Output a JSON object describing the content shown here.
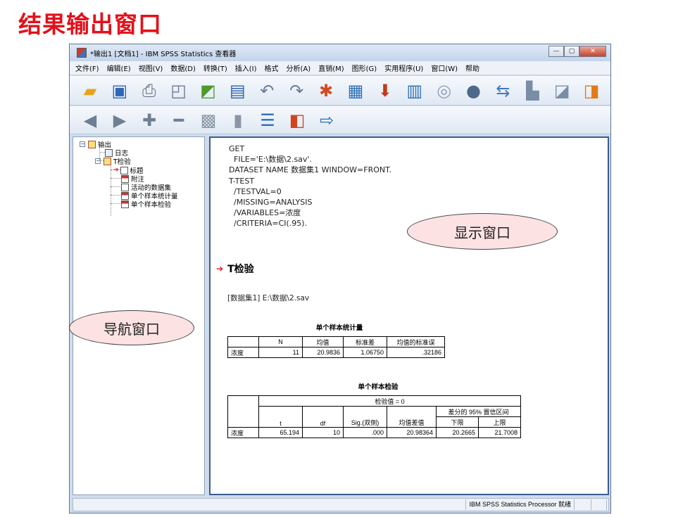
{
  "slide": {
    "title": "结果输出窗口"
  },
  "window": {
    "title": "*输出1 [文档1] - IBM SPSS Statistics 查看器",
    "buttons": {
      "minimize": "—",
      "maximize": "▢",
      "close": "✕"
    }
  },
  "menu": [
    "文件(F)",
    "编辑(E)",
    "视图(V)",
    "数据(D)",
    "转换(T)",
    "插入(I)",
    "格式",
    "分析(A)",
    "直销(M)",
    "图形(G)",
    "实用程序(U)",
    "窗口(W)",
    "帮助"
  ],
  "toolbar1_icons": [
    "open-folder-icon",
    "save-icon",
    "print-icon",
    "print-preview-icon",
    "export-icon",
    "recall-dialog-icon",
    "undo-icon",
    "redo-icon",
    "goto-data-icon",
    "goto-case-icon",
    "goto-variable-icon",
    "variables-icon",
    "use-sets-icon",
    "show-all-variables-icon",
    "spelling-icon",
    "designate-window-icon",
    "script-icon",
    "output-icon"
  ],
  "toolbar2_icons": [
    "back-icon",
    "forward-icon",
    "expand-icon",
    "collapse-icon",
    "show-icon",
    "hide-icon",
    "insert-heading-icon",
    "insert-title-icon",
    "insert-text-icon"
  ],
  "navigator": {
    "root": "输出",
    "log": "日志",
    "ttest": "T检验",
    "children": [
      "标题",
      "附注",
      "活动的数据集",
      "单个样本统计量",
      "单个样本检验"
    ]
  },
  "syntax": [
    "GET",
    "  FILE='E:\\数据\\2.sav'.",
    "DATASET NAME 数据集1 WINDOW=FRONT.",
    "T-TEST",
    "  /TESTVAL=0",
    "  /MISSING=ANALYSIS",
    "  /VARIABLES=浓度",
    "  /CRITERIA=CI(.95)."
  ],
  "section_title": "T检验",
  "dataset_line": "[数据集1] E:\\数据\\2.sav",
  "stats_table": {
    "title": "单个样本统计量",
    "headers": [
      "",
      "N",
      "均值",
      "标准差",
      "均值的标准误"
    ],
    "row": [
      "浓度",
      "11",
      "20.9836",
      "1.06750",
      ".32186"
    ]
  },
  "test_table": {
    "title": "单个样本检验",
    "test_value": "检验值 = 0",
    "ci_header": "差分的 95% 置信区间",
    "headers": [
      "t",
      "df",
      "Sig.(双侧)",
      "均值差值",
      "下限",
      "上限"
    ],
    "row": [
      "浓度",
      "65.194",
      "10",
      ".000",
      "20.98364",
      "20.2665",
      "21.7008"
    ]
  },
  "status": {
    "processor": "IBM SPSS Statistics Processor 就绪"
  },
  "callouts": {
    "display": "显示窗口",
    "nav": "导航窗口"
  }
}
